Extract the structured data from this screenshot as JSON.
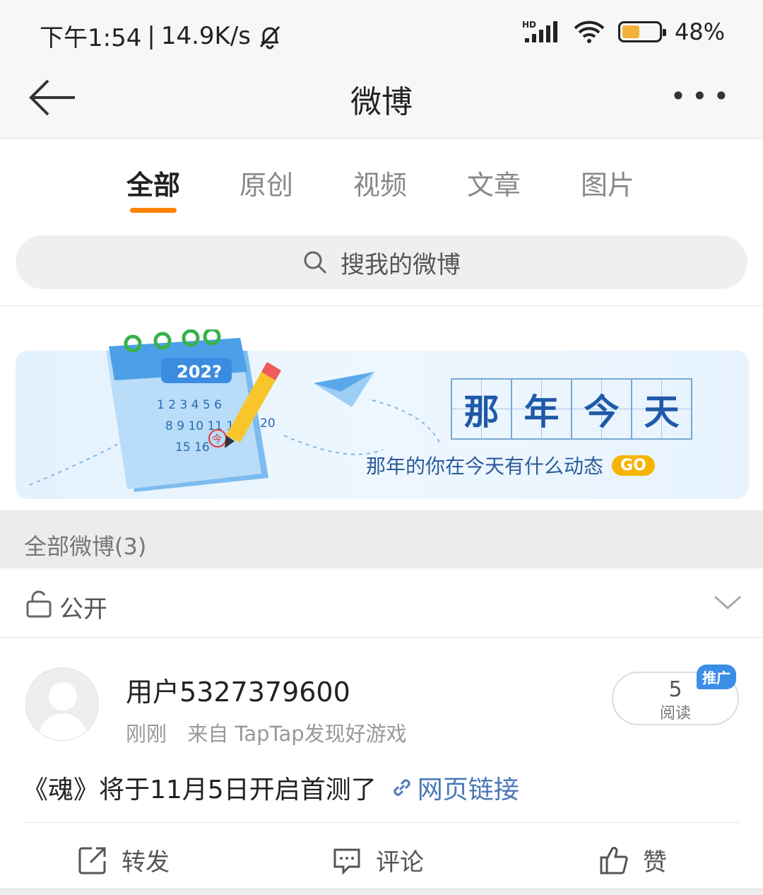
{
  "status_bar": {
    "time": "下午1:54",
    "separator": "|",
    "net_speed": "14.9K/s",
    "hd": "HD",
    "battery_level": 0.48,
    "battery_text": "48%",
    "battery_color": "#f3b23a"
  },
  "nav": {
    "title": "微博"
  },
  "tabs": [
    {
      "label": "全部",
      "active": true
    },
    {
      "label": "原创",
      "active": false
    },
    {
      "label": "视频",
      "active": false
    },
    {
      "label": "文章",
      "active": false
    },
    {
      "label": "图片",
      "active": false
    }
  ],
  "accent_color": "#ff8200",
  "search": {
    "placeholder": "搜我的微博"
  },
  "banner": {
    "year": "202?",
    "cal_rows": [
      "1 2 3 4 5 6",
      "8 9 10 11 12",
      "15 16"
    ],
    "cal_extra": "20",
    "cal_stamp": "今",
    "title_chars": [
      "那",
      "年",
      "今",
      "天"
    ],
    "subtitle": "那年的你在今天有什么动态",
    "go": "GO"
  },
  "section": {
    "title": "全部微博(3)"
  },
  "visibility": {
    "label": "公开"
  },
  "post": {
    "username": "用户5327379600",
    "time": "刚刚",
    "source": "来自 TapTap发现好游戏",
    "reads_count": "5",
    "reads_label": "阅读",
    "promo_badge": "推广",
    "text": "《魂》将于11月5日开启首测了",
    "link_text": "网页链接"
  },
  "actions": {
    "repost": "转发",
    "comment": "评论",
    "like": "赞"
  }
}
